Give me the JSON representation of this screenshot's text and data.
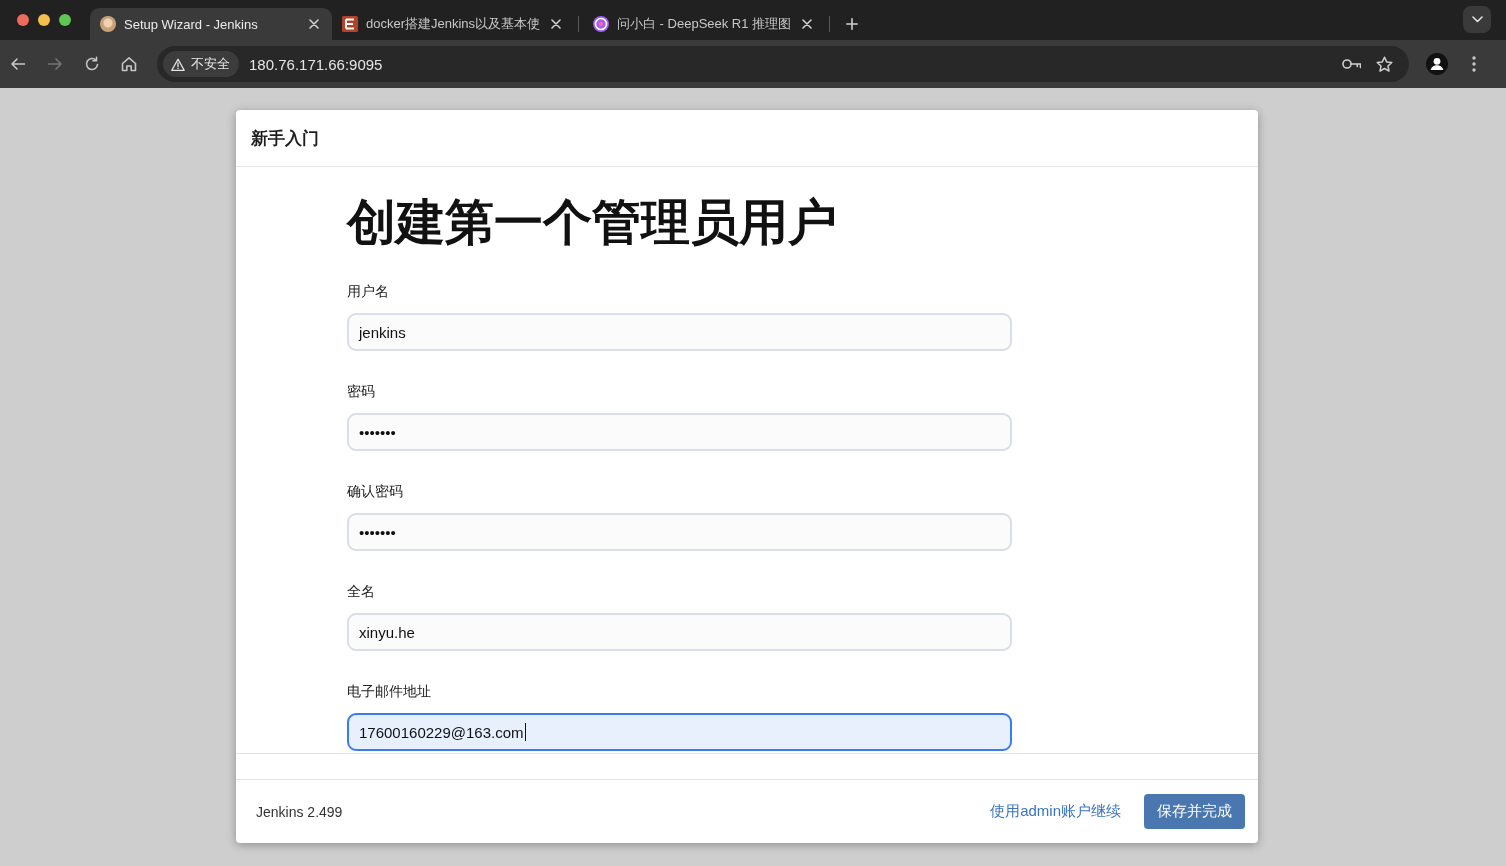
{
  "browser": {
    "tabs": [
      {
        "title": "Setup Wizard - Jenkins",
        "selected": true
      },
      {
        "title": "docker搭建Jenkins以及基本使",
        "selected": false
      },
      {
        "title": "问小白 - DeepSeek R1 推理图",
        "selected": false
      }
    ],
    "toolbar": [
      {
        "kind": "back",
        "disabled": false
      },
      {
        "kind": "forward",
        "disabled": true
      },
      {
        "kind": "reload",
        "disabled": false
      },
      {
        "kind": "home",
        "disabled": false
      }
    ],
    "address_bar": {
      "security_label": "不安全",
      "url": "180.76.171.66:9095"
    }
  },
  "dialog": {
    "title": "新手入门",
    "heading": "创建第一个管理员用户",
    "fields": [
      {
        "label": "用户名",
        "value": "jenkins",
        "focused": false
      },
      {
        "label": "密码",
        "value": "•••••••",
        "focused": false
      },
      {
        "label": "确认密码",
        "value": "•••••••",
        "focused": false
      },
      {
        "label": "全名",
        "value": "xinyu.he",
        "focused": false
      },
      {
        "label": "电子邮件地址",
        "value": "17600160229@163.com",
        "focused": true
      }
    ],
    "footer": {
      "version": "Jenkins 2.499",
      "link": "使用admin账户继续",
      "button": "保存并完成"
    }
  }
}
